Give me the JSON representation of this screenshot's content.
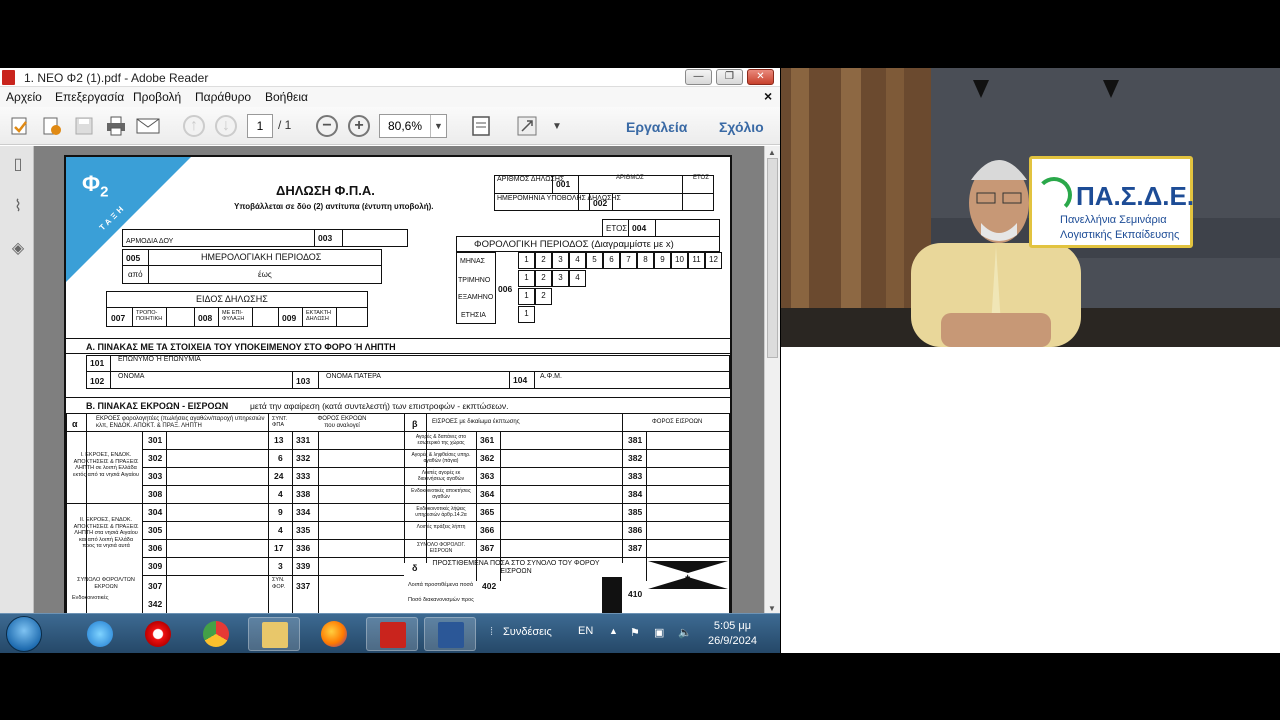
{
  "window": {
    "title": "1. ΝΕΟ Φ2 (1).pdf - Adobe Reader",
    "min_glyph": "—",
    "max_glyph": "❐",
    "close_glyph": "✕"
  },
  "menu": {
    "items": [
      "Αρχείο",
      "Επεξεργασία",
      "Προβολή",
      "Παράθυρο",
      "Βοήθεια"
    ],
    "close_doc": "×"
  },
  "toolbar": {
    "page_current": "1",
    "page_total": "/ 1",
    "zoom": "80,6%",
    "zoom_dropdown": "▼",
    "tools_label": "Εργαλεία",
    "comment_label": "Σχόλιο"
  },
  "form": {
    "phi": "Φ",
    "phi_sub": "2",
    "band": "ΤΑΞΗ",
    "title": "ΔΗΛΩΣΗ Φ.Π.Α.",
    "subtitle": "Υποβάλλεται σε δύο (2) αντίτυπα (έντυπη υποβολή).",
    "arithmos_label": "ΑΡΙΘΜΟΣ ΔΗΛΩΣΗΣ",
    "c001": "001",
    "arithmos_small": "ΑΡΙΘΜΟΣ",
    "etos_small": "ΕΤΟΣ",
    "hmer_label": "ΗΜΕΡΟΜΗΝΙΑ ΥΠΟΒΟΛΗΣ ΔΗΛΩΣΗΣ",
    "c002": "002",
    "doy_label": "ΑΡΜΟΔΙΑ ΔΟΥ",
    "c003": "003",
    "etos_label": "ΕΤΟΣ",
    "c004": "004",
    "c005": "005",
    "period_label": "ΗΜΕΡΟΛΟΓΙΑΚΗ ΠΕΡΙΟΔΟΣ",
    "apo": "από",
    "eos": "έως",
    "tax_period_label": "ΦΟΡΟΛΟΓΙΚΗ ΠΕΡΙΟΔΟΣ (Διαγραμμίστε με x)",
    "mhnas": "ΜΗΝΑΣ",
    "trimhno": "ΤΡΙΜΗΝΟ",
    "examhno": "ΕΞΑΜΗΝΟ",
    "ethsia": "ΕΤΗΣΙΑ",
    "c006": "006",
    "months": [
      "1",
      "2",
      "3",
      "4",
      "5",
      "6",
      "7",
      "8",
      "9",
      "10",
      "11",
      "12"
    ],
    "quarters": [
      "1",
      "2",
      "3",
      "4"
    ],
    "halves": [
      "1",
      "2"
    ],
    "year": [
      "1"
    ],
    "eidos_label": "ΕΙΔΟΣ ΔΗΛΩΣΗΣ",
    "c007": "007",
    "tropo": "ΤΡΟΠΟ-ΠΟΙΗΤΙΚΗ",
    "c008": "008",
    "me_epi": "ΜΕ ΕΠΙ-ΦΥΛΑΞΗ",
    "c009": "009",
    "ektakth": "ΕΚΤΑΚΤΗ ΔΗΛΩΣΗ",
    "sectA": "Α. ΠΙΝΑΚΑΣ ΜΕ ΤΑ ΣΤΟΙΧΕΙΑ ΤΟΥ ΥΠΟΚΕΙΜΕΝΟΥ ΣΤΟ ΦΟΡΟ Ή ΛΗΠΤΗ",
    "c101": "101",
    "eponymo": "ΕΠΩΝΥΜΟ Ή ΕΠΩΝΥΜΙΑ",
    "c102": "102",
    "onoma": "ΟΝΟΜΑ",
    "c103": "103",
    "onoma_patera": "ΟΝΟΜΑ ΠΑΤΕΡΑ",
    "c104": "104",
    "afm": "Α.Φ.Μ.",
    "sectB": "Β. ΠΙΝΑΚΑΣ ΕΚΡΟΩΝ - ΕΙΣΡΟΩΝ",
    "sectB_note": "μετά την αφαίρεση (κατά συντελεστή) των επιστροφών - εκπτώσεων.",
    "alpha": "α",
    "beta": "β",
    "delta": "δ",
    "ekroes_head": "ΕΚΡΟΕΣ φορολογητέες (πωλήσεις αγαθών/παροχή υπηρεσιών κλπ, ΕΝΔΟΚ. ΑΠΟΚΤ. & ΠΡΑΞ. ΛΗΠΤΗ",
    "syntel_head": "ΣΥΝΤ. ΦΠΑ",
    "foros_ekroon": "ΦΟΡΟΣ ΕΚΡΟΩΝ που αναλογεί",
    "eisroes_head": "ΕΙΣΡΟΕΣ με δικαίωμα έκπτωσης",
    "foros_eisroon": "ΦΟΡΟΣ ΕΙΣΡΟΩΝ",
    "group1": "I. ΕΚΡΟΕΣ, ΕΝΔΟΚ. ΑΠΟΚΤΗΣΕΙΣ & ΠΡΑΞΕΙΣ ΛΗΠΤΗ σε λοιπή Ελλάδα εκτός από τα νησιά Αιγαίου",
    "group2": "II. ΕΚΡΟΕΣ, ΕΝΔΟΚ. ΑΠΟΚΤΗΣΕΙΣ & ΠΡΑΞΕΙΣ ΛΗΠΤΗ στα νησιά Αιγαίου και από λοιπή Ελλάδα προς τα νησιά αυτά",
    "rows": [
      {
        "a": "301",
        "rate": "13",
        "b": "331",
        "in_label": "Αγορές & δαπάνες στο εσωτερικό της χώρας",
        "c": "361",
        "d": "381"
      },
      {
        "a": "302",
        "rate": "6",
        "b": "332",
        "in_label": "Αγορές & ληφθείσες υπηρ. αγαθών (πάγια)",
        "c": "362",
        "d": "382"
      },
      {
        "a": "303",
        "rate": "24",
        "b": "333",
        "in_label": "Λοιπές αγορές εκ διακινήσεως αγαθών",
        "c": "363",
        "d": "383"
      },
      {
        "a": "308",
        "rate": "4",
        "b": "338",
        "in_label": "Ενδοκοινοτικές αποκτήσεις αγαθών",
        "c": "364",
        "d": "384"
      },
      {
        "a": "304",
        "rate": "9",
        "b": "334",
        "in_label": "Ενδοκοινοτικές λήψεις υπηρεσιών άρθρ.14.2α",
        "c": "365",
        "d": "385"
      },
      {
        "a": "305",
        "rate": "4",
        "b": "335",
        "in_label": "Λοιπές πράξεις λήπτη",
        "c": "366",
        "d": "386"
      },
      {
        "a": "306",
        "rate": "17",
        "b": "336",
        "in_label": "ΣΥΝΟΛΟ ΦΟΡΟΛΟΓ. ΕΙΣΡΟΩΝ",
        "c": "367",
        "d": "387"
      },
      {
        "a": "309",
        "rate": "3",
        "b": "339"
      }
    ],
    "prostithemena": "ΠΡΟΣΤΙΘΕΜΕΝΑ ΠΟΣΑ ΣΤΟ ΣΥΝΟΛΟ ΤΟΥ ΦΟΡΟΥ ΕΙΣΡΟΩΝ",
    "synolo_label": "ΣΥΝΟΛΟ ΦΟΡΟΛ/ΤΩΝ ΕΚΡΟΩΝ",
    "c307": "307",
    "syn_for": "ΣΥΝ. ΦΟΡ.",
    "c337": "337",
    "c402": "402",
    "c402_label": "Λοιπά προστιθέμενα ποσά",
    "c410": "410",
    "c342": "342",
    "endo_label": "Ενδοκοινοτικές",
    "ypo_label": "Ποσό διακανονισμών προς",
    "plus": "+"
  },
  "taskbar": {
    "syndeseis": "Συνδέσεις",
    "lang": "EN",
    "time": "5:05 μμ",
    "date": "26/9/2024"
  },
  "video": {
    "logo_main": "ΠΑ.Σ.Δ.Ε.",
    "logo_line1": "Πανελλήνια Σεμινάρια",
    "logo_line2": "Λογιστικής Εκπαίδευσης"
  },
  "colors": {
    "form_blue": "#3a9fd7",
    "acrobat_red": "#c9241d",
    "logo_blue": "#1d4c96",
    "logo_green": "#2aa84a",
    "logo_border": "#e2c33f",
    "link_blue": "#3a6aa5"
  }
}
